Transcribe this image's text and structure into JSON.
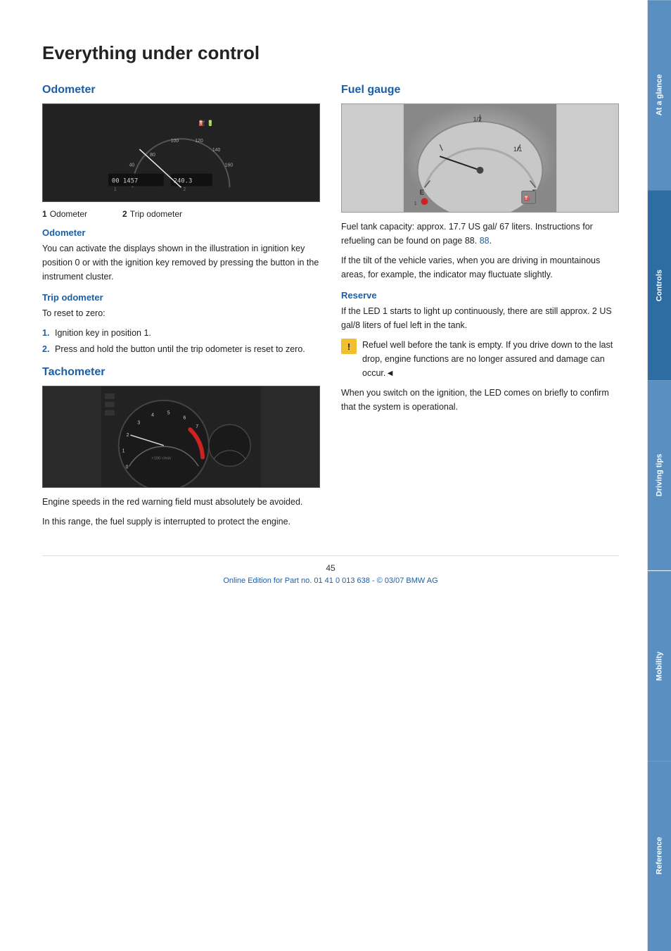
{
  "page": {
    "title": "Everything under control",
    "page_number": "45",
    "footer_text": "Online Edition for Part no. 01 41 0 013 638 - © 03/07 BMW AG"
  },
  "tabs": [
    {
      "id": "at-a-glance",
      "label": "At a glance",
      "active": false
    },
    {
      "id": "controls",
      "label": "Controls",
      "active": true
    },
    {
      "id": "driving-tips",
      "label": "Driving tips",
      "active": false
    },
    {
      "id": "mobility",
      "label": "Mobility",
      "active": false
    },
    {
      "id": "reference",
      "label": "Reference",
      "active": false
    }
  ],
  "odometer": {
    "section_title": "Odometer",
    "labels": [
      {
        "num": "1",
        "text": "Odometer"
      },
      {
        "num": "2",
        "text": "Trip odometer"
      }
    ],
    "odo_value": "00 1457",
    "trip_value": "240.3",
    "subsections": [
      {
        "title": "Odometer",
        "body": "You can activate the displays shown in the illustration in ignition key position 0 or with the ignition key removed by pressing the button in the instrument cluster."
      },
      {
        "title": "Trip odometer",
        "intro": "To reset to zero:",
        "steps": [
          "Ignition key in position 1.",
          "Press and hold the button until the trip odometer is reset to zero."
        ]
      }
    ]
  },
  "fuel_gauge": {
    "section_title": "Fuel gauge",
    "body1": "Fuel tank capacity: approx. 17.7 US gal/ 67 liters. Instructions for refueling can be found on page 88.",
    "body2": "If the tilt of the vehicle varies, when you are driving in mountainous areas, for example, the indicator may fluctuate slightly.",
    "reserve": {
      "title": "Reserve",
      "body": "If the LED 1 starts to light up continuously, there are still approx. 2 US gal/8 liters of fuel left in the tank.",
      "warning": "Refuel well before the tank is empty. If you drive down to the last drop, engine functions are no longer assured and damage can occur.◄",
      "body2": "When you switch on the ignition, the LED comes on briefly to confirm that the system is operational."
    }
  },
  "tachometer": {
    "section_title": "Tachometer",
    "body1": "Engine speeds in the red warning field must absolutely be avoided.",
    "body2": "In this range, the fuel supply is interrupted to protect the engine."
  }
}
